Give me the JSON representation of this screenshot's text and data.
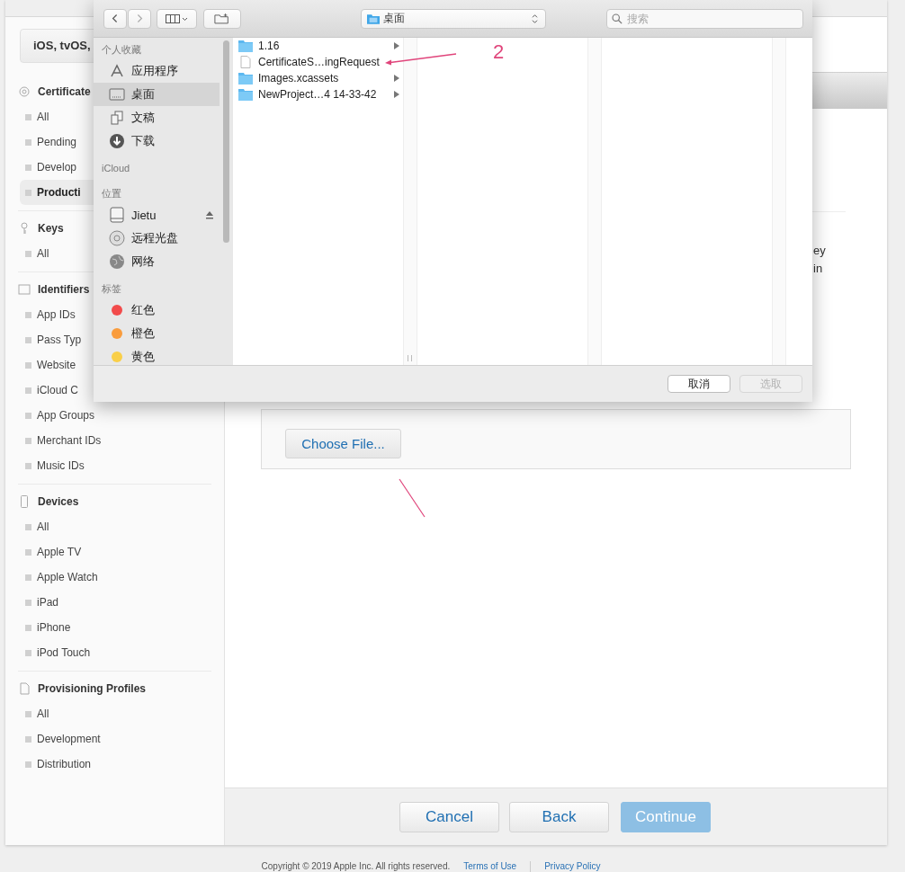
{
  "page": {
    "platform_select": "iOS, tvOS,",
    "sidebar": [
      {
        "heading": "Certificate",
        "kind": "certificate",
        "items": [
          {
            "label": "All",
            "selected": false
          },
          {
            "label": "Pending",
            "selected": false
          },
          {
            "label": "Develop",
            "selected": false
          },
          {
            "label": "Producti",
            "selected": true
          }
        ]
      },
      {
        "heading": "Keys",
        "kind": "key",
        "items": [
          {
            "label": "All",
            "selected": false
          }
        ]
      },
      {
        "heading": "Identifiers",
        "kind": "id",
        "items": [
          {
            "label": "App IDs",
            "selected": false
          },
          {
            "label": "Pass Typ",
            "selected": false
          },
          {
            "label": "Website",
            "selected": false
          },
          {
            "label": "iCloud C",
            "selected": false
          },
          {
            "label": "App Groups",
            "selected": false
          },
          {
            "label": "Merchant IDs",
            "selected": false
          },
          {
            "label": "Music IDs",
            "selected": false
          }
        ]
      },
      {
        "heading": "Devices",
        "kind": "device",
        "items": [
          {
            "label": "All",
            "selected": false
          },
          {
            "label": "Apple TV",
            "selected": false
          },
          {
            "label": "Apple Watch",
            "selected": false
          },
          {
            "label": "iPad",
            "selected": false
          },
          {
            "label": "iPhone",
            "selected": false
          },
          {
            "label": "iPod Touch",
            "selected": false
          }
        ]
      },
      {
        "heading": "Provisioning Profiles",
        "kind": "profile",
        "items": [
          {
            "label": "All",
            "selected": false
          },
          {
            "label": "Development",
            "selected": false
          },
          {
            "label": "Distribution",
            "selected": false
          }
        ]
      }
    ],
    "content": {
      "partial_lines": [
        "ey",
        "in"
      ],
      "choose_file": "Choose File...",
      "buttons": [
        {
          "label": "Cancel",
          "disabled": false
        },
        {
          "label": "Back",
          "disabled": false
        },
        {
          "label": "Continue",
          "disabled": true
        }
      ]
    },
    "footer": {
      "copyright": "Copyright © 2019 Apple Inc. All rights reserved.",
      "links": [
        "Terms of Use",
        "Privacy Policy"
      ]
    }
  },
  "dialog": {
    "location": "桌面",
    "search": {
      "placeholder": "搜索"
    },
    "sidebar": [
      {
        "heading": "个人收藏",
        "items": [
          {
            "label": "应用程序",
            "kind": "apps",
            "selected": false
          },
          {
            "label": "桌面",
            "kind": "desktop",
            "selected": true
          },
          {
            "label": "文稿",
            "kind": "documents",
            "selected": false
          },
          {
            "label": "下载",
            "kind": "downloads",
            "selected": false
          }
        ]
      },
      {
        "heading": "iCloud"
      },
      {
        "heading": "位置",
        "items": [
          {
            "label": "Jietu",
            "kind": "drive",
            "selected": false
          },
          {
            "label": "远程光盘",
            "kind": "disc",
            "selected": false
          },
          {
            "label": "网络",
            "kind": "network",
            "selected": false
          }
        ]
      },
      {
        "heading": "标签",
        "items": [
          {
            "label": "红色",
            "kind": "tag",
            "color": "#f24b4b",
            "selected": false
          },
          {
            "label": "橙色",
            "kind": "tag",
            "color": "#f99c3d",
            "selected": false
          },
          {
            "label": "黄色",
            "kind": "tag",
            "color": "#f9cf49",
            "selected": false
          }
        ]
      }
    ],
    "files": [
      {
        "name": "1.16",
        "kind": "folder",
        "expandable": true
      },
      {
        "name": "CertificateS…ingRequest",
        "kind": "file",
        "expandable": false
      },
      {
        "name": "Images.xcassets",
        "kind": "folder",
        "expandable": true
      },
      {
        "name": "NewProject…4 14-33-42",
        "kind": "folder",
        "expandable": true
      }
    ],
    "buttons": [
      {
        "label": "取消",
        "disabled": false
      },
      {
        "label": "选取",
        "disabled": true
      }
    ]
  },
  "annotation": {
    "label": "2"
  }
}
